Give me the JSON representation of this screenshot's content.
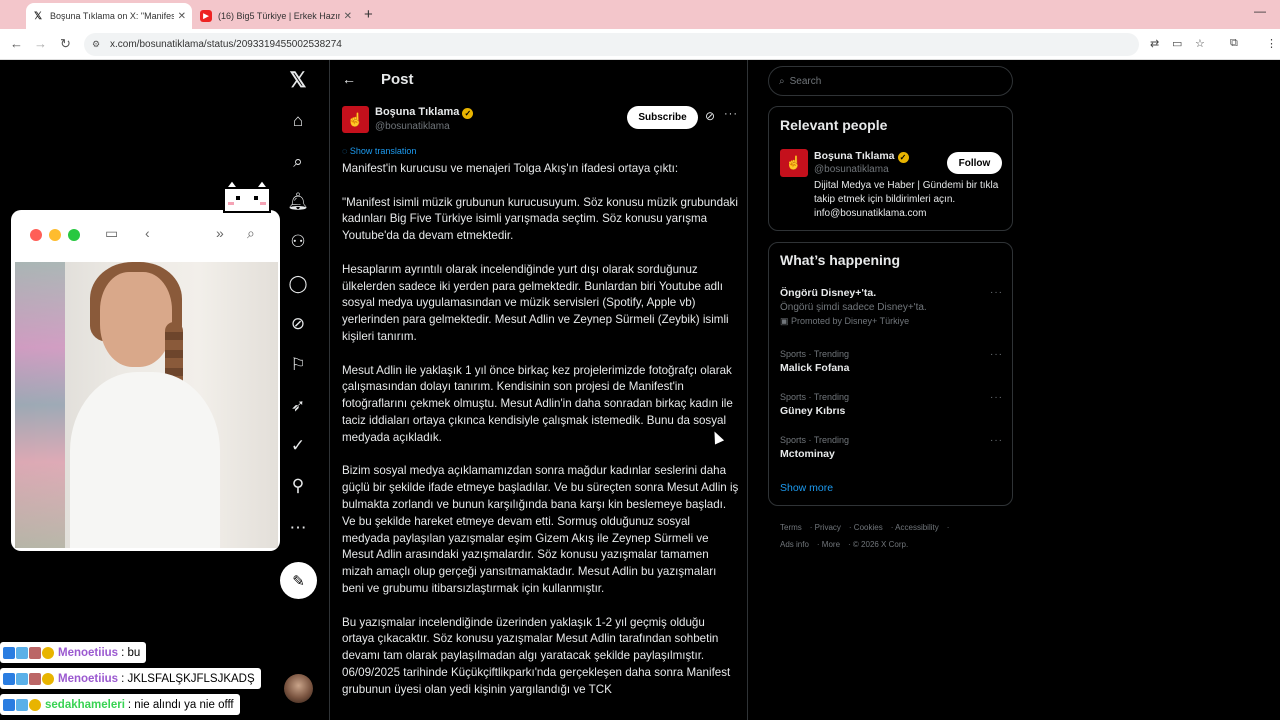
{
  "browser": {
    "tabs": [
      {
        "title": "Boşuna Tıklama on X: \"Manifest",
        "favicon": "X",
        "active": true
      },
      {
        "title": "(16) Big5 Türkiye | Erkek Hazırlık",
        "favicon": "▶",
        "active": false
      }
    ],
    "new_tab": "+",
    "minimize": "—",
    "url": "x.com/bosunatiklama/status/2093319455002538274"
  },
  "sidebar": {
    "icons": [
      "x-logo",
      "home",
      "search",
      "notifications",
      "follow",
      "messages",
      "grok",
      "bookmarks",
      "premium",
      "verified-orgs",
      "profile",
      "more"
    ],
    "compose_icon": "✎"
  },
  "post": {
    "header_title": "Post",
    "author_name": "Boşuna Tıklama",
    "author_handle": "@bosunatiklama",
    "subscribe_label": "Subscribe",
    "show_translation": "Show translation",
    "paragraphs": [
      "Manifest'in kurucusu ve menajeri Tolga Akış'ın ifadesi ortaya çıktı:",
      "\"Manifest isimli müzik grubunun kurucusuyum. Söz konusu müzik grubundaki kadınları Big Five Türkiye isimli yarışmada seçtim. Söz konusu yarışma Youtube'da da devam etmektedir.",
      "Hesaplarım ayrıntılı olarak incelendiğinde yurt dışı olarak sorduğunuz ülkelerden sadece iki yerden para gelmektedir. Bunlardan biri Youtube adlı sosyal medya uygulamasından ve müzik servisleri (Spotify, Apple vb) yerlerinden para gelmektedir. Mesut Adlin ve Zeynep Sürmeli (Zeybik) isimli kişileri tanırım.",
      "Mesut Adlin ile yaklaşık 1 yıl önce birkaç kez projelerimizde fotoğrafçı olarak çalışmasından dolayı tanırım. Kendisinin son projesi de Manifest'in fotoğraflarını çekmek olmuştu. Mesut Adlin'in daha sonradan birkaç kadın ile taciz iddiaları ortaya çıkınca kendisiyle çalışmak istemedik. Bunu da sosyal medyada açıkladık.",
      "Bizim sosyal medya açıklamamızdan sonra mağdur kadınlar seslerini daha güçlü bir şekilde ifade etmeye başladılar. Ve bu süreçten sonra Mesut Adlin iş bulmakta zorlandı ve bunun karşılığında bana karşı kin beslemeye başladı. Ve bu şekilde hareket etmeye devam etti. Sormuş olduğunuz sosyal medyada paylaşılan yazışmalar eşim Gizem Akış ile Zeynep Sürmeli ve Mesut Adlin arasındaki yazışmalardır. Söz konusu yazışmalar tamamen mizah amaçlı olup gerçeği yansıtmamaktadır. Mesut Adlin bu yazışmaları beni ve grubumu itibarsızlaştırmak için kullanmıştır.",
      "Bu yazışmalar incelendiğinde üzerinden yaklaşık 1-2 yıl geçmiş olduğu ortaya çıkacaktır. Söz konusu yazışmalar Mesut Adlin tarafından sohbetin devamı tam olarak paylaşılmadan algı yaratacak şekilde paylaşılmıştır. 06/09/2025 tarihinde Küçükçiftlikparkı'nda gerçekleşen daha sonra Manifest grubunun üyesi olan yedi kişinin yargılandığı ve TCK"
    ]
  },
  "right": {
    "search_placeholder": "Search",
    "relevant_title": "Relevant people",
    "person": {
      "name": "Boşuna Tıklama",
      "handle": "@bosunatiklama",
      "bio": "Dijital Medya ve Haber | Gündemi bir tıkla takip etmek için bildirimleri açın. info@bosunatiklama.com",
      "follow_label": "Follow"
    },
    "happening_title": "What’s happening",
    "trends": [
      {
        "meta": "",
        "name": "Öngörü Disney+'ta.",
        "desc": "Öngörü şimdi sadece Disney+'ta.",
        "promo": "Promoted by Disney+ Türkiye"
      },
      {
        "meta": "Sports · Trending",
        "name": "Malick Fofana"
      },
      {
        "meta": "Sports · Trending",
        "name": "Güney Kıbrıs"
      },
      {
        "meta": "Sports · Trending",
        "name": "Mctominay"
      }
    ],
    "show_more": "Show more",
    "footer": [
      "Terms",
      "Privacy",
      "Cookies",
      "Accessibility",
      "Ads info",
      "More",
      "© 2026 X Corp."
    ]
  },
  "chat": [
    {
      "user": "Menoetiius",
      "message": ": bu",
      "user_color": "#9b59d0"
    },
    {
      "user": "Menoetiius",
      "message": ": JKLSFALŞKJFLSJKADŞ",
      "user_color": "#9b59d0"
    },
    {
      "user": "sedakhameleri",
      "message": ": nie alındı ya nie offf",
      "user_color": "#39d353"
    }
  ],
  "colors": {
    "accent": "#1d9bf0",
    "tabbar": "#f3c6cb",
    "brand_red": "#c4101c"
  }
}
